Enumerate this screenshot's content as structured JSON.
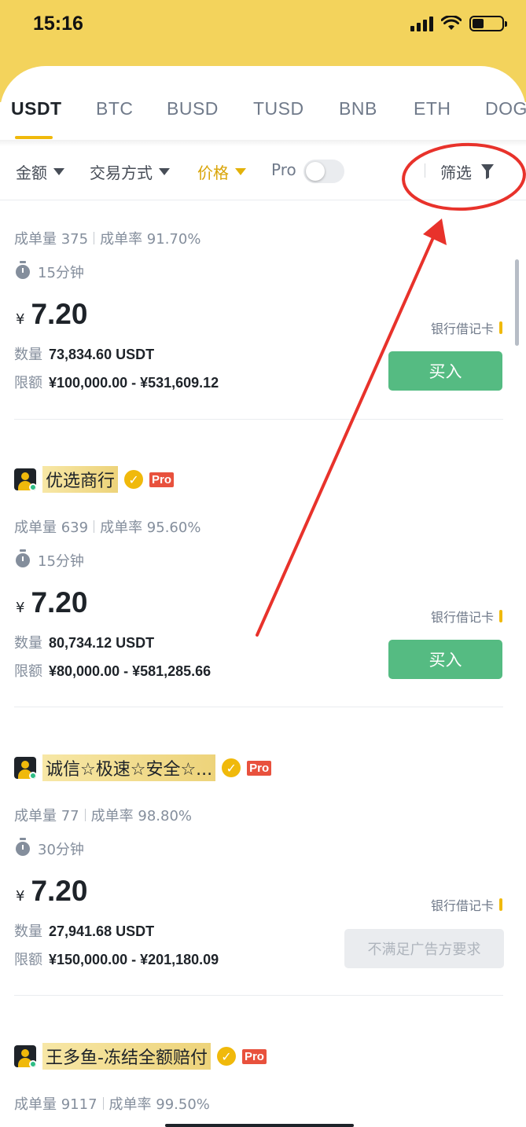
{
  "status": {
    "time": "15:16"
  },
  "tabs": [
    "USDT",
    "BTC",
    "BUSD",
    "TUSD",
    "BNB",
    "ETH",
    "DOG"
  ],
  "filters": {
    "amount": "金额",
    "payment": "交易方式",
    "price": "价格",
    "pro": "Pro",
    "filter": "筛选"
  },
  "ads": [
    {
      "stats_orders": "成单量 375",
      "stats_rate": "成单率 91.70%",
      "time_limit": "15分钟",
      "currency": "¥",
      "price": "7.20",
      "payment": "银行借记卡",
      "qty_label": "数量",
      "qty": "73,834.60 USDT",
      "limit_label": "限额",
      "limit": "¥100,000.00 - ¥531,609.12",
      "button": "买入"
    },
    {
      "name": "优选商行",
      "pro": "Pro",
      "verified": "✓",
      "stats_orders": "成单量 639",
      "stats_rate": "成单率 95.60%",
      "time_limit": "15分钟",
      "currency": "¥",
      "price": "7.20",
      "payment": "银行借记卡",
      "qty_label": "数量",
      "qty": "80,734.12 USDT",
      "limit_label": "限额",
      "limit": "¥80,000.00 - ¥581,285.66",
      "button": "买入"
    },
    {
      "name": "诚信☆极速☆安全☆...",
      "pro": "Pro",
      "verified": "✓",
      "stats_orders": "成单量 77",
      "stats_rate": "成单率 98.80%",
      "time_limit": "30分钟",
      "currency": "¥",
      "price": "7.20",
      "payment": "银行借记卡",
      "qty_label": "数量",
      "qty": "27,941.68 USDT",
      "limit_label": "限额",
      "limit": "¥150,000.00 - ¥201,180.09",
      "button": "不满足广告方要求"
    },
    {
      "name": "王多鱼-冻结全额赔付",
      "pro": "Pro",
      "verified": "✓",
      "stats_orders": "成单量 9117",
      "stats_rate": "成单率 99.50%"
    }
  ],
  "colors": {
    "brand_yellow": "#f3d35c",
    "accent": "#f0b90b",
    "buy_green": "#55bb82",
    "pro_red": "#e8513d",
    "annotation_red": "#e8322b"
  }
}
